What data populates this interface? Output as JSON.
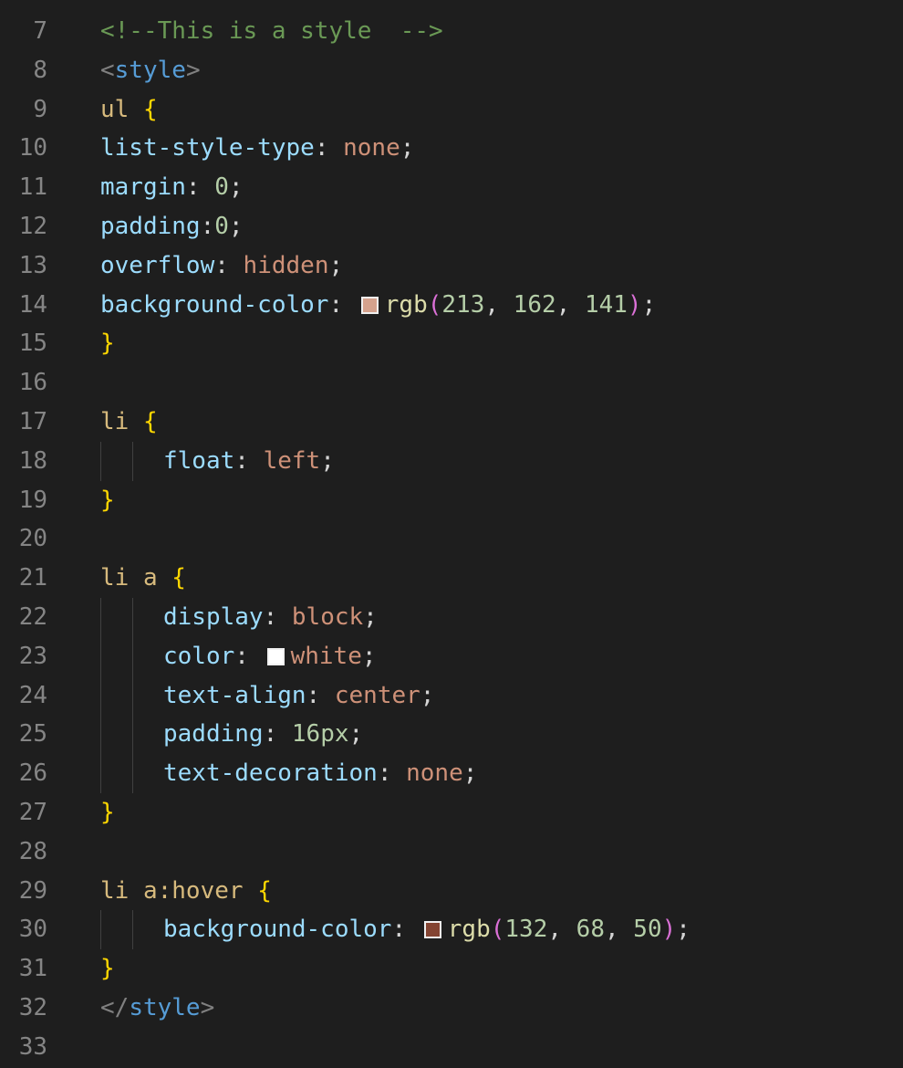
{
  "editor": {
    "theme_colors": {
      "background": "#1e1e1e",
      "line_number": "#858585",
      "comment": "#6a9955",
      "tag": "#569cd6",
      "tag_bracket": "#808080",
      "selector": "#d7ba7d",
      "brace": "#ffd700",
      "paren": "#da70d6",
      "property": "#9cdcfe",
      "value": "#ce9178",
      "number": "#b5cea8",
      "function": "#dcdcaa",
      "punctuation": "#d4d4d4"
    },
    "lines": [
      {
        "number": "7",
        "indent": 0,
        "tokens": [
          {
            "t": "<!--This is a style  -->",
            "c": "comment"
          }
        ]
      },
      {
        "number": "8",
        "indent": 0,
        "tokens": [
          {
            "t": "<",
            "c": "punct"
          },
          {
            "t": "style",
            "c": "tag"
          },
          {
            "t": ">",
            "c": "punct"
          }
        ]
      },
      {
        "number": "9",
        "indent": 0,
        "tokens": [
          {
            "t": "ul ",
            "c": "sel"
          },
          {
            "t": "{",
            "c": "brace"
          }
        ]
      },
      {
        "number": "10",
        "indent": 0,
        "tokens": [
          {
            "t": "list-style-type",
            "c": "prop"
          },
          {
            "t": ": ",
            "c": "plain"
          },
          {
            "t": "none",
            "c": "val"
          },
          {
            "t": ";",
            "c": "plain"
          }
        ]
      },
      {
        "number": "11",
        "indent": 0,
        "tokens": [
          {
            "t": "margin",
            "c": "prop"
          },
          {
            "t": ": ",
            "c": "plain"
          },
          {
            "t": "0",
            "c": "num"
          },
          {
            "t": ";",
            "c": "plain"
          }
        ]
      },
      {
        "number": "12",
        "indent": 0,
        "tokens": [
          {
            "t": "padding",
            "c": "prop"
          },
          {
            "t": ":",
            "c": "plain"
          },
          {
            "t": "0",
            "c": "num"
          },
          {
            "t": ";",
            "c": "plain"
          }
        ]
      },
      {
        "number": "13",
        "indent": 0,
        "tokens": [
          {
            "t": "overflow",
            "c": "prop"
          },
          {
            "t": ": ",
            "c": "plain"
          },
          {
            "t": "hidden",
            "c": "val"
          },
          {
            "t": ";",
            "c": "plain"
          }
        ]
      },
      {
        "number": "14",
        "indent": 0,
        "tokens": [
          {
            "t": "background-color",
            "c": "prop"
          },
          {
            "t": ": ",
            "c": "plain"
          },
          {
            "swatch": "rgb(213, 162, 141)"
          },
          {
            "t": "rgb",
            "c": "fn"
          },
          {
            "t": "(",
            "c": "paren"
          },
          {
            "t": "213",
            "c": "num"
          },
          {
            "t": ", ",
            "c": "plain"
          },
          {
            "t": "162",
            "c": "num"
          },
          {
            "t": ", ",
            "c": "plain"
          },
          {
            "t": "141",
            "c": "num"
          },
          {
            "t": ")",
            "c": "paren"
          },
          {
            "t": ";",
            "c": "plain"
          }
        ]
      },
      {
        "number": "15",
        "indent": 0,
        "tokens": [
          {
            "t": "}",
            "c": "brace"
          }
        ]
      },
      {
        "number": "16",
        "indent": 0,
        "tokens": []
      },
      {
        "number": "17",
        "indent": 0,
        "tokens": [
          {
            "t": "li ",
            "c": "sel"
          },
          {
            "t": "{",
            "c": "brace"
          }
        ]
      },
      {
        "number": "18",
        "indent": 1,
        "tokens": [
          {
            "t": "float",
            "c": "prop"
          },
          {
            "t": ": ",
            "c": "plain"
          },
          {
            "t": "left",
            "c": "val"
          },
          {
            "t": ";",
            "c": "plain"
          }
        ]
      },
      {
        "number": "19",
        "indent": 0,
        "tokens": [
          {
            "t": "}",
            "c": "brace"
          }
        ]
      },
      {
        "number": "20",
        "indent": 0,
        "tokens": []
      },
      {
        "number": "21",
        "indent": 0,
        "tokens": [
          {
            "t": "li a ",
            "c": "sel"
          },
          {
            "t": "{",
            "c": "brace"
          }
        ]
      },
      {
        "number": "22",
        "indent": 1,
        "tokens": [
          {
            "t": "display",
            "c": "prop"
          },
          {
            "t": ": ",
            "c": "plain"
          },
          {
            "t": "block",
            "c": "val"
          },
          {
            "t": ";",
            "c": "plain"
          }
        ]
      },
      {
        "number": "23",
        "indent": 1,
        "tokens": [
          {
            "t": "color",
            "c": "prop"
          },
          {
            "t": ": ",
            "c": "plain"
          },
          {
            "swatch": "#ffffff"
          },
          {
            "t": "white",
            "c": "val"
          },
          {
            "t": ";",
            "c": "plain"
          }
        ]
      },
      {
        "number": "24",
        "indent": 1,
        "tokens": [
          {
            "t": "text-align",
            "c": "prop"
          },
          {
            "t": ": ",
            "c": "plain"
          },
          {
            "t": "center",
            "c": "val"
          },
          {
            "t": ";",
            "c": "plain"
          }
        ]
      },
      {
        "number": "25",
        "indent": 1,
        "tokens": [
          {
            "t": "padding",
            "c": "prop"
          },
          {
            "t": ": ",
            "c": "plain"
          },
          {
            "t": "16px",
            "c": "num"
          },
          {
            "t": ";",
            "c": "plain"
          }
        ]
      },
      {
        "number": "26",
        "indent": 1,
        "tokens": [
          {
            "t": "text-decoration",
            "c": "prop"
          },
          {
            "t": ": ",
            "c": "plain"
          },
          {
            "t": "none",
            "c": "val"
          },
          {
            "t": ";",
            "c": "plain"
          }
        ]
      },
      {
        "number": "27",
        "indent": 0,
        "tokens": [
          {
            "t": "}",
            "c": "brace"
          }
        ]
      },
      {
        "number": "28",
        "indent": 0,
        "tokens": []
      },
      {
        "number": "29",
        "indent": 0,
        "tokens": [
          {
            "t": "li a:hover ",
            "c": "sel"
          },
          {
            "t": "{",
            "c": "brace"
          }
        ]
      },
      {
        "number": "30",
        "indent": 1,
        "tokens": [
          {
            "t": "background-color",
            "c": "prop"
          },
          {
            "t": ": ",
            "c": "plain"
          },
          {
            "swatch": "rgb(132, 68, 50)"
          },
          {
            "t": "rgb",
            "c": "fn"
          },
          {
            "t": "(",
            "c": "paren"
          },
          {
            "t": "132",
            "c": "num"
          },
          {
            "t": ", ",
            "c": "plain"
          },
          {
            "t": "68",
            "c": "num"
          },
          {
            "t": ", ",
            "c": "plain"
          },
          {
            "t": "50",
            "c": "num"
          },
          {
            "t": ")",
            "c": "paren"
          },
          {
            "t": ";",
            "c": "plain"
          }
        ]
      },
      {
        "number": "31",
        "indent": 0,
        "tokens": [
          {
            "t": "}",
            "c": "brace"
          }
        ]
      },
      {
        "number": "32",
        "indent": 0,
        "tokens": [
          {
            "t": "</",
            "c": "punct"
          },
          {
            "t": "style",
            "c": "tag"
          },
          {
            "t": ">",
            "c": "punct"
          }
        ]
      },
      {
        "number": "33",
        "indent": 0,
        "tokens": []
      }
    ]
  }
}
